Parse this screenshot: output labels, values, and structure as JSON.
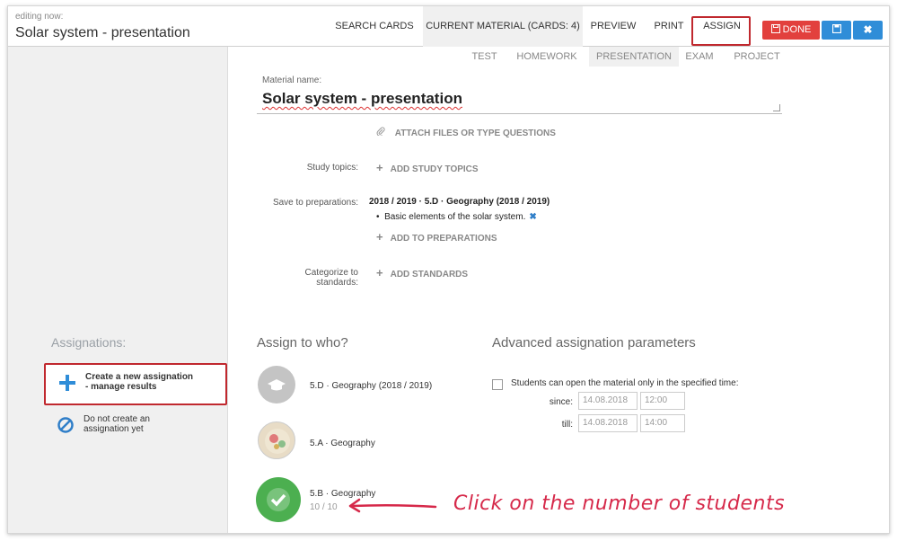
{
  "header": {
    "editing_label": "editing now:",
    "title": "Solar system - presentation",
    "nav": {
      "search_cards": "SEARCH CARDS",
      "current_material": "CURRENT MATERIAL (CARDS: 4)",
      "preview": "PREVIEW",
      "print": "PRINT",
      "assign": "ASSIGN"
    },
    "done_label": "DONE",
    "save_icon": "save-icon",
    "close_label": "✖"
  },
  "subtabs": [
    "TEST",
    "HOMEWORK",
    "PRESENTATION",
    "EXAM",
    "PROJECT"
  ],
  "material": {
    "name_label": "Material name:",
    "name_value": "Solar system - presentation",
    "attach_label": "ATTACH FILES OR TYPE QUESTIONS"
  },
  "study_topics": {
    "label": "Study topics:",
    "action": "ADD STUDY TOPICS"
  },
  "preparations": {
    "label": "Save to preparations:",
    "title": "2018 / 2019 · 5.D · Geography (2018 / 2019)",
    "item": "Basic elements of the solar system.",
    "action": "ADD TO PREPARATIONS"
  },
  "standards": {
    "label_line1": "Categorize to",
    "label_line2": "standards:",
    "action": "ADD STANDARDS"
  },
  "sidebar": {
    "heading": "Assignations:",
    "options": [
      {
        "line1": "Create a new assignation",
        "line2": "- manage results",
        "icon": "plus-icon"
      },
      {
        "line1": "Do not create an",
        "line2": "assignation yet",
        "icon": "prohibit-icon"
      }
    ]
  },
  "assign_to": {
    "title": "Assign to who?",
    "classes": [
      {
        "name": "5.D · Geography (2018 / 2019)"
      },
      {
        "name": "5.A · Geography"
      },
      {
        "name": "5.B · Geography",
        "count": "10 / 10"
      }
    ]
  },
  "advanced": {
    "title": "Advanced assignation parameters",
    "restrict_label": "Students can open the material only in the specified time:",
    "since_label": "since:",
    "since_date": "14.08.2018",
    "since_time": "12:00",
    "till_label": "till:",
    "till_date": "14.08.2018",
    "till_time": "14:00"
  },
  "annotation": "Click on the number of students",
  "colors": {
    "accent_red": "#c0282e",
    "done_red": "#e2403d",
    "blue": "#2f8dd8",
    "green": "#4caf50"
  }
}
